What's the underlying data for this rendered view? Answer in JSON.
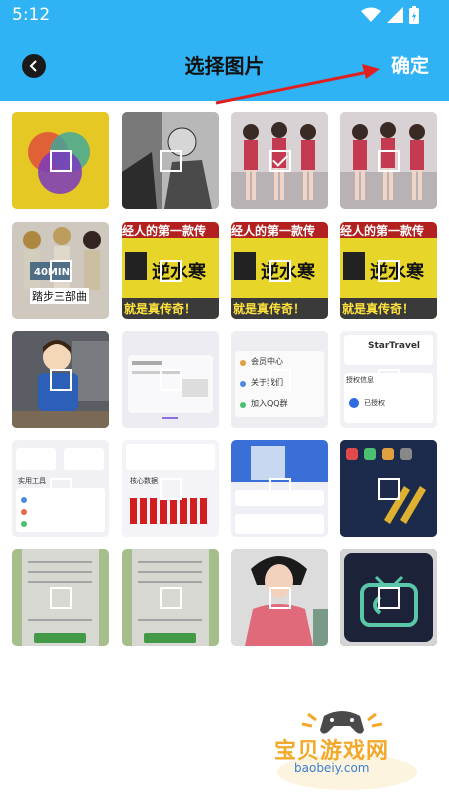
{
  "status_bar": {
    "time": "5:12"
  },
  "header": {
    "title": "选择图片",
    "confirm_label": "确定"
  },
  "thumbnails": [
    {
      "id": "t1",
      "checked": false,
      "theme": "color-circles"
    },
    {
      "id": "t2",
      "checked": false,
      "theme": "manga"
    },
    {
      "id": "t3",
      "checked": true,
      "theme": "dancers"
    },
    {
      "id": "t4",
      "checked": false,
      "theme": "dancers"
    },
    {
      "id": "t5",
      "checked": false,
      "theme": "dance-poster",
      "text": "踏步三部曲",
      "badge": "40MIN"
    },
    {
      "id": "t6",
      "checked": false,
      "theme": "game-banner",
      "top": "经人的第一款传",
      "mid": "逆水寒",
      "bottom": "就是真传奇！"
    },
    {
      "id": "t7",
      "checked": false,
      "theme": "game-banner",
      "top": "经人的第一款传",
      "mid": "逆水寒",
      "bottom": "就是真传奇！"
    },
    {
      "id": "t8",
      "checked": false,
      "theme": "game-banner",
      "top": "经人的第一款传",
      "mid": "逆水寒",
      "bottom": "就是真传奇！"
    },
    {
      "id": "t9",
      "checked": false,
      "theme": "avatar"
    },
    {
      "id": "t10",
      "checked": false,
      "theme": "app-screen-a"
    },
    {
      "id": "t11",
      "checked": false,
      "theme": "app-screen-b",
      "items": [
        "会员中心",
        "关于我们",
        "加入QQ群"
      ]
    },
    {
      "id": "t12",
      "checked": false,
      "theme": "startravel",
      "title": "StarTravel",
      "sub": "授权信息",
      "status": "已授权"
    },
    {
      "id": "t13",
      "checked": false,
      "theme": "app-tools",
      "label": "实用工具"
    },
    {
      "id": "t14",
      "checked": false,
      "theme": "red-bars",
      "label": "核心数据"
    },
    {
      "id": "t15",
      "checked": false,
      "theme": "game-list"
    },
    {
      "id": "t16",
      "checked": false,
      "theme": "dark-phone"
    },
    {
      "id": "t17",
      "checked": false,
      "theme": "doc-green"
    },
    {
      "id": "t18",
      "checked": false,
      "theme": "doc-green"
    },
    {
      "id": "t19",
      "checked": false,
      "theme": "girl"
    },
    {
      "id": "t20",
      "checked": false,
      "theme": "tv-logo"
    }
  ],
  "watermark": {
    "name": "宝贝游戏网",
    "url": "baobeiy.com"
  },
  "colors": {
    "appbar": "#2fb3f5",
    "arrow": "#e02020",
    "watermark": "#f2a92a"
  }
}
